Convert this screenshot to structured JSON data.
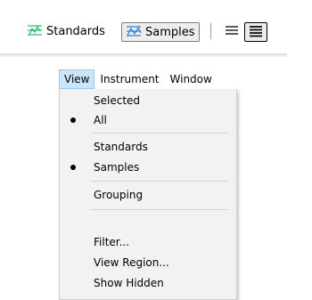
{
  "toolbar": {
    "standards_label": "Standards",
    "samples_label": "Samples",
    "icons": [
      "standards-icon",
      "samples-icon",
      "list-view-icon",
      "detail-view-icon"
    ],
    "accent_green": "#2fb36b",
    "accent_blue": "#2e7fd0"
  },
  "menubar": {
    "items": [
      {
        "label": "View",
        "active": true
      },
      {
        "label": "Instrument",
        "active": false
      },
      {
        "label": "Window",
        "active": false
      }
    ]
  },
  "view_menu": {
    "items": [
      {
        "label": "Selected",
        "checked": false
      },
      {
        "label": "All",
        "checked": true
      },
      {
        "label": "Standards",
        "checked": false
      },
      {
        "label": "Samples",
        "checked": true
      },
      {
        "label": "Grouping",
        "checked": false
      },
      {
        "label": "Filter...",
        "checked": false
      },
      {
        "label": "View Region...",
        "checked": false
      },
      {
        "label": "Show Hidden",
        "checked": false
      }
    ]
  }
}
